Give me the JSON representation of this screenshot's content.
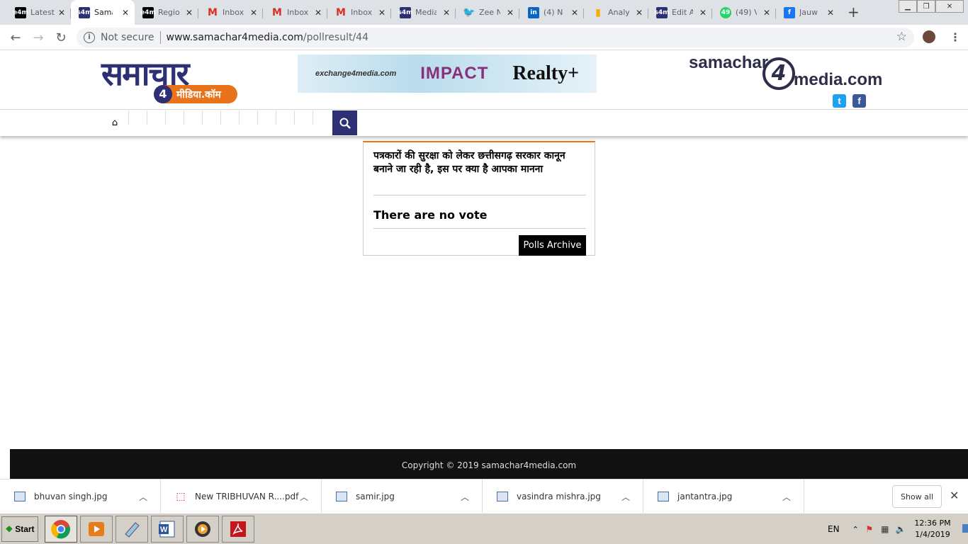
{
  "browser": {
    "tabs": [
      {
        "title": "Latest",
        "favicon": "e4m",
        "color": "#000000",
        "active": false
      },
      {
        "title": "Samachar",
        "favicon": "s4m",
        "color": "#2d3174",
        "active": true
      },
      {
        "title": "Regional",
        "favicon": "e4m",
        "color": "#000000",
        "active": false
      },
      {
        "title": "Inbox",
        "favicon": "M",
        "color": "#d93025",
        "active": false
      },
      {
        "title": "Inbox",
        "favicon": "M",
        "color": "#d93025",
        "active": false
      },
      {
        "title": "Inbox",
        "favicon": "M",
        "color": "#d93025",
        "active": false
      },
      {
        "title": "Media",
        "favicon": "s4m",
        "color": "#2d3174",
        "active": false
      },
      {
        "title": "Zee N",
        "favicon": "twitter",
        "color": "#1da1f2",
        "active": false
      },
      {
        "title": "(4) N",
        "favicon": "in",
        "color": "#0a66c2",
        "active": false
      },
      {
        "title": "Analy",
        "favicon": "analytics",
        "color": "#f9ab00",
        "active": false
      },
      {
        "title": "Edit A",
        "favicon": "s4m",
        "color": "#2d3174",
        "active": false
      },
      {
        "title": "(49) V",
        "favicon": "49",
        "color": "#25d366",
        "active": false
      },
      {
        "title": "Jauw",
        "favicon": "f",
        "color": "#1877f2",
        "active": false
      }
    ],
    "address": {
      "security": "Not secure",
      "url_host": "www.samachar4media.com",
      "url_path": "/pollresult/44"
    }
  },
  "site": {
    "logo_hindi": {
      "main": "समाचार",
      "sub": "मीडिया.कॉम",
      "four": "4"
    },
    "banner": {
      "part1": "exchange4media.com",
      "part2": "IMPACT",
      "part3": "Realty+"
    },
    "logo_english": {
      "left": "samachar",
      "four": "4",
      "right": "media.com"
    },
    "social": {
      "twitter": "t",
      "facebook": "f"
    }
  },
  "poll": {
    "question": "पत्रकारों की सुरक्षा को लेकर छत्तीसगढ़ सरकार कानून बनाने जा रही है, इस पर क्या है आपका मानना",
    "result": "There are no vote",
    "archive_button": "Polls Archive"
  },
  "footer": {
    "copyright": "Copyright © 2019 samachar4media.com"
  },
  "downloads": {
    "items": [
      {
        "name": "bhuvan singh.jpg",
        "type": "image"
      },
      {
        "name": "New TRIBHUVAN R....pdf",
        "type": "pdf"
      },
      {
        "name": "samir.jpg",
        "type": "image"
      },
      {
        "name": "vasindra mishra.jpg",
        "type": "image"
      },
      {
        "name": "jantantra.jpg",
        "type": "image"
      }
    ],
    "show_all": "Show all"
  },
  "taskbar": {
    "start": "Start",
    "lang": "EN",
    "time": "12:36 PM",
    "date": "1/4/2019"
  }
}
